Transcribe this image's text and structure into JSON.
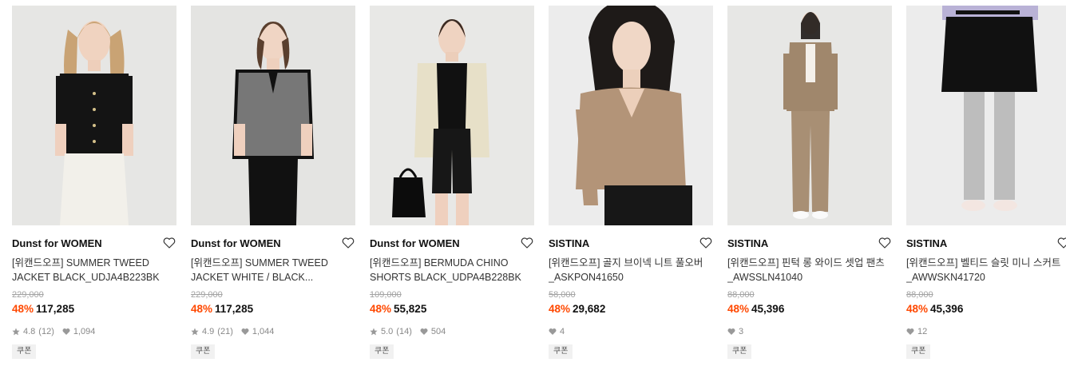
{
  "products": [
    {
      "brand": "Dunst for WOMEN",
      "name": "[위캔드오프] SUMMER TWEED JACKET BLACK_UDJA4B223BK",
      "original_price": "229,000",
      "discount": "48%",
      "price": "117,285",
      "rating": "4.8",
      "reviews": "(12)",
      "likes": "1,094",
      "coupon": "쿠폰"
    },
    {
      "brand": "Dunst for WOMEN",
      "name": "[위캔드오프] SUMMER TWEED JACKET WHITE / BLACK...",
      "original_price": "229,000",
      "discount": "48%",
      "price": "117,285",
      "rating": "4.9",
      "reviews": "(21)",
      "likes": "1,044",
      "coupon": "쿠폰"
    },
    {
      "brand": "Dunst for WOMEN",
      "name": "[위캔드오프] BERMUDA CHINO SHORTS BLACK_UDPA4B228BK",
      "original_price": "109,000",
      "discount": "48%",
      "price": "55,825",
      "rating": "5.0",
      "reviews": "(14)",
      "likes": "504",
      "coupon": "쿠폰"
    },
    {
      "brand": "SISTINA",
      "name": "[위캔드오프] 골지 브이넥 니트 풀오버 _ASKPON41650",
      "original_price": "58,000",
      "discount": "48%",
      "price": "29,682",
      "likes": "4",
      "coupon": "쿠폰"
    },
    {
      "brand": "SISTINA",
      "name": "[위캔드오프] 핀턱 롱 와이드 셋업 팬츠 _AWSSLN41040",
      "original_price": "88,000",
      "discount": "48%",
      "price": "45,396",
      "likes": "3",
      "coupon": "쿠폰"
    },
    {
      "brand": "SISTINA",
      "name": "[위캔드오프] 벨티드 슬릿 미니 스커트 _AWWSKN41720",
      "original_price": "88,000",
      "discount": "48%",
      "price": "45,396",
      "likes": "12",
      "coupon": "쿠폰"
    }
  ],
  "colors": {
    "discount": "#ff4800",
    "strike": "#a3a3a3",
    "meta": "#888888"
  }
}
